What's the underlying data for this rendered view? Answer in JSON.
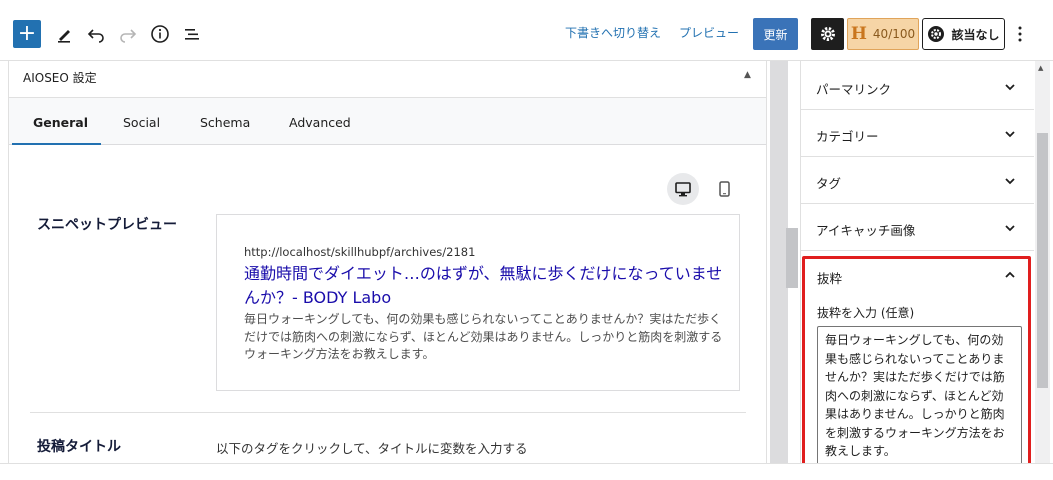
{
  "toolbar": {
    "add_label": "+",
    "switch_draft": "下書きへ切り替え",
    "preview": "プレビュー",
    "update": "更新",
    "headline_score": "40/100",
    "headline_mark": "H",
    "aioseo_status": "該当なし"
  },
  "aioseo": {
    "panel_title": "AIOSEO 設定",
    "tabs": [
      {
        "label": "General"
      },
      {
        "label": "Social"
      },
      {
        "label": "Schema"
      },
      {
        "label": "Advanced"
      }
    ],
    "snippet_label": "スニペットプレビュー",
    "snippet": {
      "url": "http://localhost/skillhubpf/archives/2181",
      "title": "通勤時間でダイエット…のはずが、無駄に歩くだけになっていませんか？- BODY Labo",
      "description": "毎日ウォーキングしても、何の効果も感じられないってことありませんか？実はただ歩くだけでは筋肉への刺激にならず、ほとんど効果はありません。しっかりと筋肉を刺激するウォーキング方法をお教えします。"
    },
    "post_title_label": "投稿タイトル",
    "post_title_hint": "以下のタグをクリックして、タイトルに変数を入力する"
  },
  "sidebar": {
    "items": [
      {
        "label": "パーマリンク"
      },
      {
        "label": "カテゴリー"
      },
      {
        "label": "タグ"
      },
      {
        "label": "アイキャッチ画像"
      }
    ],
    "excerpt": {
      "title": "抜粋",
      "field_label": "抜粋を入力 (任意)",
      "value": "毎日ウォーキングしても、何の効果も感じられないってことありませんか？実はただ歩くだけでは筋肉への刺激にならず、ほとんど効果はありません。しっかりと筋肉を刺激するウォーキング方法をお教えします。"
    }
  },
  "colors": {
    "accent": "#2271b1",
    "highlight_border": "#e01e1e",
    "snippet_title": "#1a0dab"
  }
}
